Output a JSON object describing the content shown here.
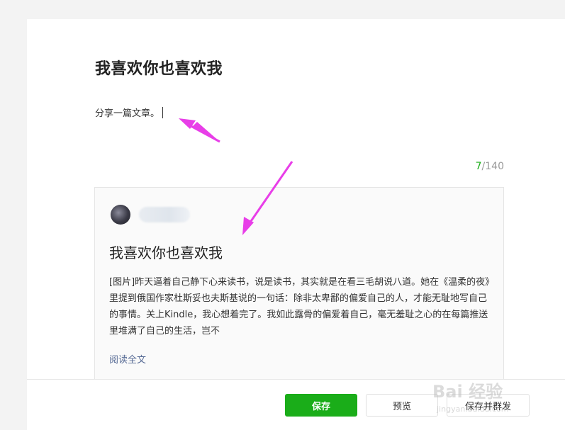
{
  "post": {
    "title": "我喜欢你也喜欢我",
    "comment": "分享一篇文章。",
    "counter_current": "7",
    "counter_max": "/140"
  },
  "preview": {
    "title": "我喜欢你也喜欢我",
    "excerpt": "[图片]昨天逼着自己静下心来读书，说是读书，其实就是在看三毛胡说八道。她在《温柔的夜》里提到俄国作家杜斯妥也夫斯基说的一句话：除非太卑鄙的偏爱自己的人，才能无耻地写自己的事情。关上Kindle，我心想着完了。我如此露骨的偏爱着自己，毫无羞耻之心的在每篇推送里堆满了自己的生活，岂不",
    "read_more": "阅读全文"
  },
  "footer": {
    "save_label": "保存",
    "preview_label": "预览",
    "send_label": "保存并群发"
  },
  "watermark": {
    "brand": "Bai 经验",
    "url": "jingyan.baidu.com"
  },
  "colors": {
    "accent": "#1aad19",
    "link": "#576b95",
    "annotation_arrow": "#e83ee8"
  }
}
